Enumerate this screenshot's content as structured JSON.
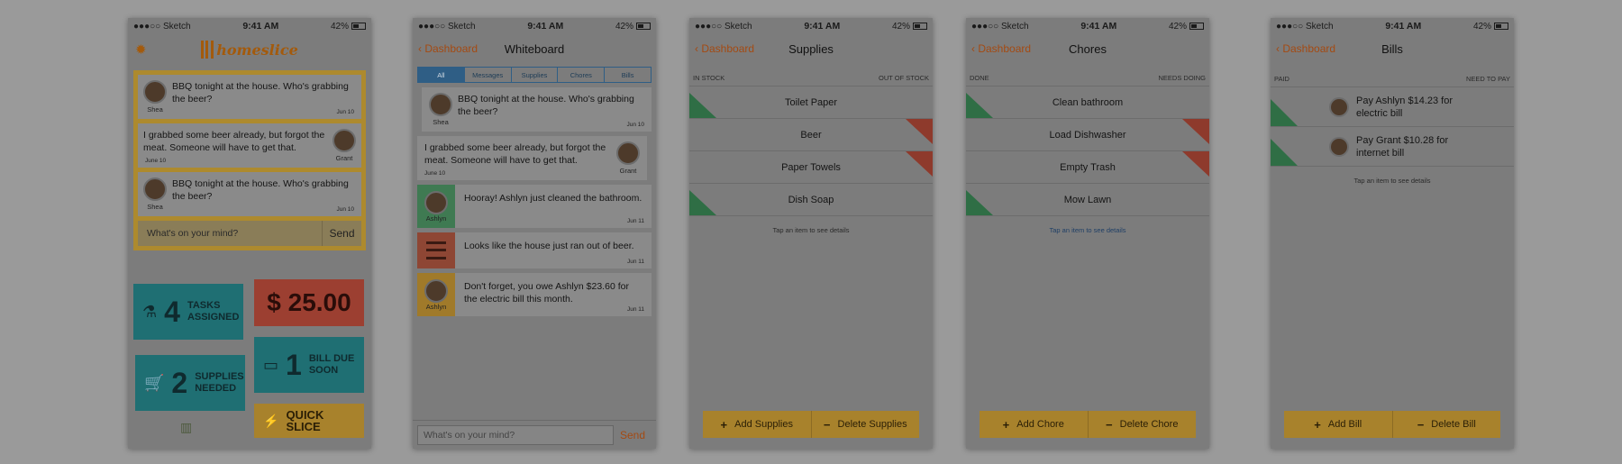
{
  "status": {
    "carrier": "●●●○○ Sketch",
    "time": "9:41 AM",
    "battery": "42%"
  },
  "home": {
    "brand": "homeslice",
    "feed": [
      {
        "name": "Shea",
        "text": "BBQ tonight at the house. Who's grabbing the beer?",
        "date": "Jun 10"
      },
      {
        "name": "Grant",
        "text": "I grabbed some beer already, but forgot the meat. Someone will have to get that.",
        "date": "June 10"
      },
      {
        "name": "Shea",
        "text": "BBQ tonight at the house. Who's grabbing the beer?",
        "date": "Jun 10"
      }
    ],
    "compose_placeholder": "What's on your mind?",
    "send_label": "Send",
    "tiles": {
      "tasks_count": "4",
      "tasks_label_1": "TASKS",
      "tasks_label_2": "ASSIGNED",
      "money": "$ 25.00",
      "supplies_count": "2",
      "supplies_label_1": "SUPPLIES",
      "supplies_label_2": "NEEDED",
      "bill_count": "1",
      "bill_label_1": "BILL DUE",
      "bill_label_2": "SOON",
      "quick_slice": "QUICK SLICE"
    }
  },
  "whiteboard": {
    "back": "Dashboard",
    "title": "Whiteboard",
    "tabs": [
      "All",
      "Messages",
      "Supplies",
      "Chores",
      "Bills"
    ],
    "items": [
      {
        "name": "Shea",
        "text": "BBQ tonight at the house. Who's grabbing the beer?",
        "date": "Jun 10"
      },
      {
        "name": "Grant",
        "text": "I grabbed some beer already, but forgot the meat. Someone will have to get that.",
        "date": "June 10"
      },
      {
        "name": "Ashlyn",
        "text": "Hooray! Ashlyn just cleaned the bathroom.",
        "date": "Jun 11"
      },
      {
        "name": "",
        "text": "Looks like the house just ran out of beer.",
        "date": "Jun 11"
      },
      {
        "name": "Ashlyn",
        "text": "Don't forget, you owe Ashlyn $23.60 for the electric bill this month.",
        "date": "Jun 11"
      }
    ],
    "compose_placeholder": "What's on your mind?",
    "send_label": "Send"
  },
  "supplies": {
    "back": "Dashboard",
    "title": "Supplies",
    "left_header": "IN STOCK",
    "right_header": "OUT OF STOCK",
    "items": [
      "Toilet Paper",
      "Beer",
      "Paper Towels",
      "Dish Soap"
    ],
    "hint": "Tap an item to see details",
    "add_label": "Add Supplies",
    "delete_label": "Delete Supplies"
  },
  "chores": {
    "back": "Dashboard",
    "title": "Chores",
    "left_header": "DONE",
    "right_header": "NEEDS DOING",
    "items": [
      "Clean bathroom",
      "Load Dishwasher",
      "Empty Trash",
      "Mow Lawn"
    ],
    "hint": "Tap an item to see details",
    "add_label": "Add Chore",
    "delete_label": "Delete Chore"
  },
  "bills": {
    "back": "Dashboard",
    "title": "Bills",
    "left_header": "PAID",
    "right_header": "NEED TO PAY",
    "items": [
      "Pay Ashlyn $14.23 for electric bill",
      "Pay Grant $10.28 for internet bill"
    ],
    "hint": "Tap an item to see details",
    "add_label": "Add Bill",
    "delete_label": "Delete Bill"
  }
}
